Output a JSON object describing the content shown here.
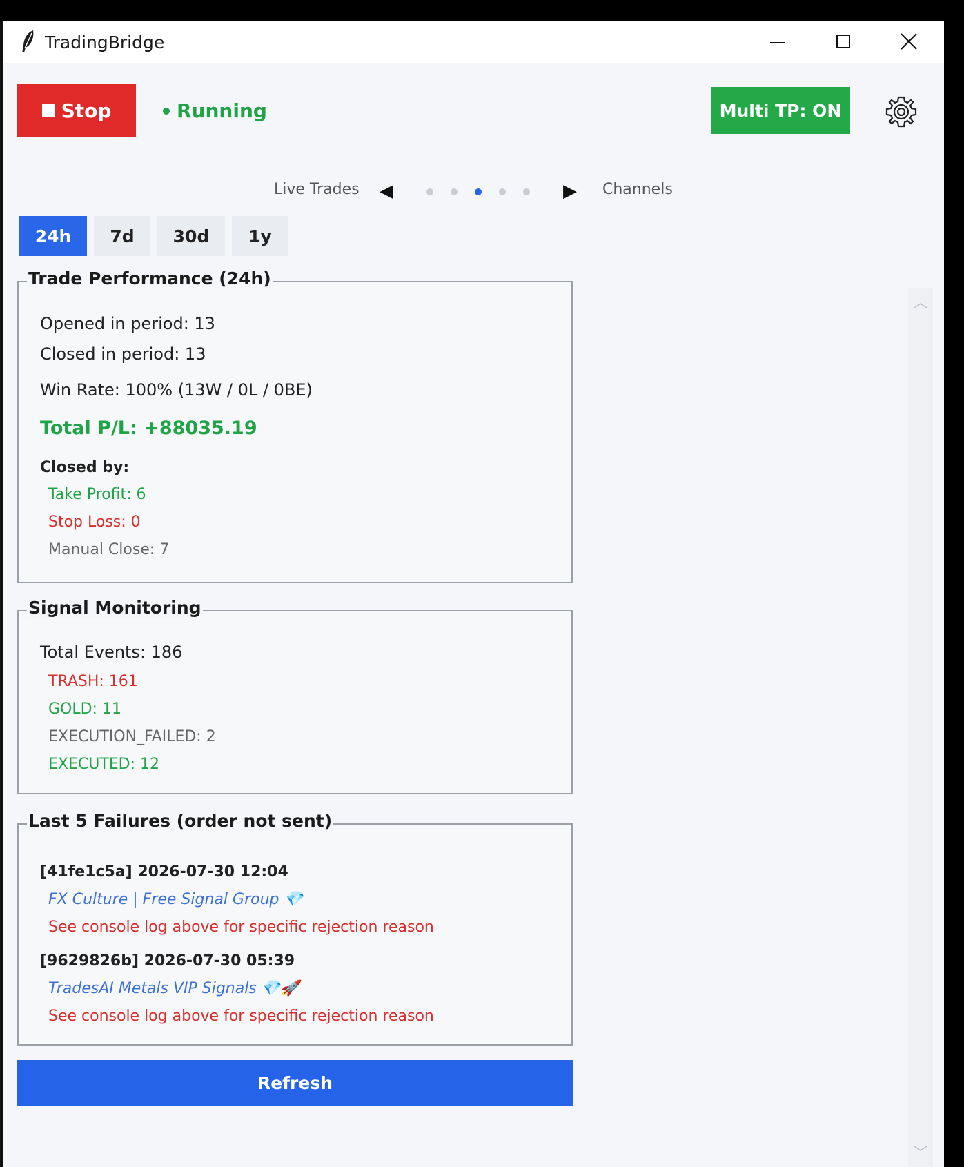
{
  "window": {
    "title": "TradingBridge"
  },
  "toolbar": {
    "stop_label": "Stop",
    "status_label": "Running",
    "multitp_label": "Multi TP: ON"
  },
  "nav": {
    "prev_label": "Live Trades",
    "next_label": "Channels",
    "active_page": 3,
    "page_count": 5
  },
  "tabs": [
    {
      "label": "24h",
      "active": true
    },
    {
      "label": "7d",
      "active": false
    },
    {
      "label": "30d",
      "active": false
    },
    {
      "label": "1y",
      "active": false
    }
  ],
  "performance": {
    "title": "Trade Performance (24h)",
    "opened": "Opened in period: 13",
    "closed": "Closed in period: 13",
    "winrate": "Win Rate: 100%  (13W / 0L / 0BE)",
    "total_pl": "Total P/L: +88035.19",
    "closed_by": "Closed by:",
    "take_profit": "Take Profit: 6",
    "stop_loss": "Stop Loss: 0",
    "manual_close": "Manual Close: 7"
  },
  "signals": {
    "title": "Signal Monitoring",
    "total": "Total Events: 186",
    "trash": "TRASH: 161",
    "gold": "GOLD: 11",
    "exec_failed": "EXECUTION_FAILED: 2",
    "executed": "EXECUTED: 12"
  },
  "failures": {
    "title": "Last 5 Failures (order not sent)",
    "items": [
      {
        "header": "[41fe1c5a]  2026-07-30 12:04",
        "channel": "FX Culture | Free Signal Group 💎",
        "reason": "See console log above for specific rejection reason"
      },
      {
        "header": "[9629826b]  2026-07-30 05:39",
        "channel": "TradesAI Metals VIP Signals 💎🚀",
        "reason": "See console log above for specific rejection reason"
      }
    ]
  },
  "refresh_label": "Refresh",
  "colors": {
    "stop": "#e02a2a",
    "running": "#1fa346",
    "multitp": "#24a948",
    "accent": "#2a67e8"
  }
}
